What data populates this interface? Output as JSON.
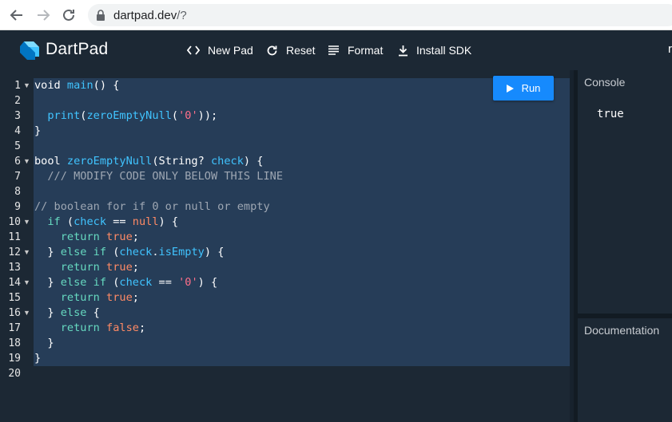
{
  "browser": {
    "url_host": "dartpad.dev",
    "url_path": "/?"
  },
  "app": {
    "brand": "DartPad",
    "toolbar": [
      {
        "label": "New Pad",
        "icon": "code-brackets-icon"
      },
      {
        "label": "Reset",
        "icon": "refresh-icon"
      },
      {
        "label": "Format",
        "icon": "format-lines-icon"
      },
      {
        "label": "Install SDK",
        "icon": "download-icon"
      }
    ],
    "cut_label": "r",
    "run_label": "Run"
  },
  "editor": {
    "line_numbers": [
      "1",
      "2",
      "3",
      "4",
      "5",
      "6",
      "7",
      "8",
      "9",
      "10",
      "11",
      "12",
      "13",
      "14",
      "15",
      "16",
      "17",
      "18",
      "19",
      "20"
    ],
    "foldable_lines": [
      1,
      6,
      10,
      12,
      14,
      16
    ],
    "lines": [
      [
        {
          "t": "void ",
          "c": "kw"
        },
        {
          "t": "main",
          "c": "fn"
        },
        {
          "t": "() {",
          "c": "kw"
        }
      ],
      [],
      [
        {
          "t": "  ",
          "c": "plain"
        },
        {
          "t": "print",
          "c": "fn"
        },
        {
          "t": "(",
          "c": "kw"
        },
        {
          "t": "zeroEmptyNull",
          "c": "fn"
        },
        {
          "t": "(",
          "c": "kw"
        },
        {
          "t": "'0'",
          "c": "str"
        },
        {
          "t": "));",
          "c": "kw"
        }
      ],
      [
        {
          "t": "}",
          "c": "kw"
        }
      ],
      [],
      [
        {
          "t": "bool ",
          "c": "kw"
        },
        {
          "t": "zeroEmptyNull",
          "c": "fn"
        },
        {
          "t": "(String? ",
          "c": "kw"
        },
        {
          "t": "check",
          "c": "fn"
        },
        {
          "t": ") {",
          "c": "kw"
        }
      ],
      [
        {
          "t": "  /// MODIFY CODE ONLY BELOW THIS LINE",
          "c": "cmt"
        }
      ],
      [],
      [
        {
          "t": "// boolean for if 0 or null or empty",
          "c": "cmt"
        }
      ],
      [
        {
          "t": "  ",
          "c": "plain"
        },
        {
          "t": "if",
          "c": "ctl"
        },
        {
          "t": " (",
          "c": "kw"
        },
        {
          "t": "check",
          "c": "fn"
        },
        {
          "t": " == ",
          "c": "kw"
        },
        {
          "t": "null",
          "c": "lit"
        },
        {
          "t": ") {",
          "c": "kw"
        }
      ],
      [
        {
          "t": "    ",
          "c": "plain"
        },
        {
          "t": "return",
          "c": "ctl"
        },
        {
          "t": " ",
          "c": "plain"
        },
        {
          "t": "true",
          "c": "lit"
        },
        {
          "t": ";",
          "c": "kw"
        }
      ],
      [
        {
          "t": "  } ",
          "c": "kw"
        },
        {
          "t": "else if",
          "c": "ctl"
        },
        {
          "t": " (",
          "c": "kw"
        },
        {
          "t": "check",
          "c": "fn"
        },
        {
          "t": ".",
          "c": "kw"
        },
        {
          "t": "isEmpty",
          "c": "fn"
        },
        {
          "t": ") {",
          "c": "kw"
        }
      ],
      [
        {
          "t": "    ",
          "c": "plain"
        },
        {
          "t": "return",
          "c": "ctl"
        },
        {
          "t": " ",
          "c": "plain"
        },
        {
          "t": "true",
          "c": "lit"
        },
        {
          "t": ";",
          "c": "kw"
        }
      ],
      [
        {
          "t": "  } ",
          "c": "kw"
        },
        {
          "t": "else if",
          "c": "ctl"
        },
        {
          "t": " (",
          "c": "kw"
        },
        {
          "t": "check",
          "c": "fn"
        },
        {
          "t": " == ",
          "c": "kw"
        },
        {
          "t": "'0'",
          "c": "str"
        },
        {
          "t": ") {",
          "c": "kw"
        }
      ],
      [
        {
          "t": "    ",
          "c": "plain"
        },
        {
          "t": "return",
          "c": "ctl"
        },
        {
          "t": " ",
          "c": "plain"
        },
        {
          "t": "true",
          "c": "lit"
        },
        {
          "t": ";",
          "c": "kw"
        }
      ],
      [
        {
          "t": "  } ",
          "c": "kw"
        },
        {
          "t": "else",
          "c": "ctl"
        },
        {
          "t": " {",
          "c": "kw"
        }
      ],
      [
        {
          "t": "    ",
          "c": "plain"
        },
        {
          "t": "return",
          "c": "ctl"
        },
        {
          "t": " ",
          "c": "plain"
        },
        {
          "t": "false",
          "c": "lit"
        },
        {
          "t": ";",
          "c": "kw"
        }
      ],
      [
        {
          "t": "  }",
          "c": "kw"
        }
      ],
      [
        {
          "t": "}",
          "c": "kw"
        }
      ],
      []
    ]
  },
  "console": {
    "title": "Console",
    "output": "true"
  },
  "documentation": {
    "title": "Documentation"
  },
  "colors": {
    "background": "#1c2834",
    "selection": "#263d58",
    "run_button": "#168afd"
  }
}
